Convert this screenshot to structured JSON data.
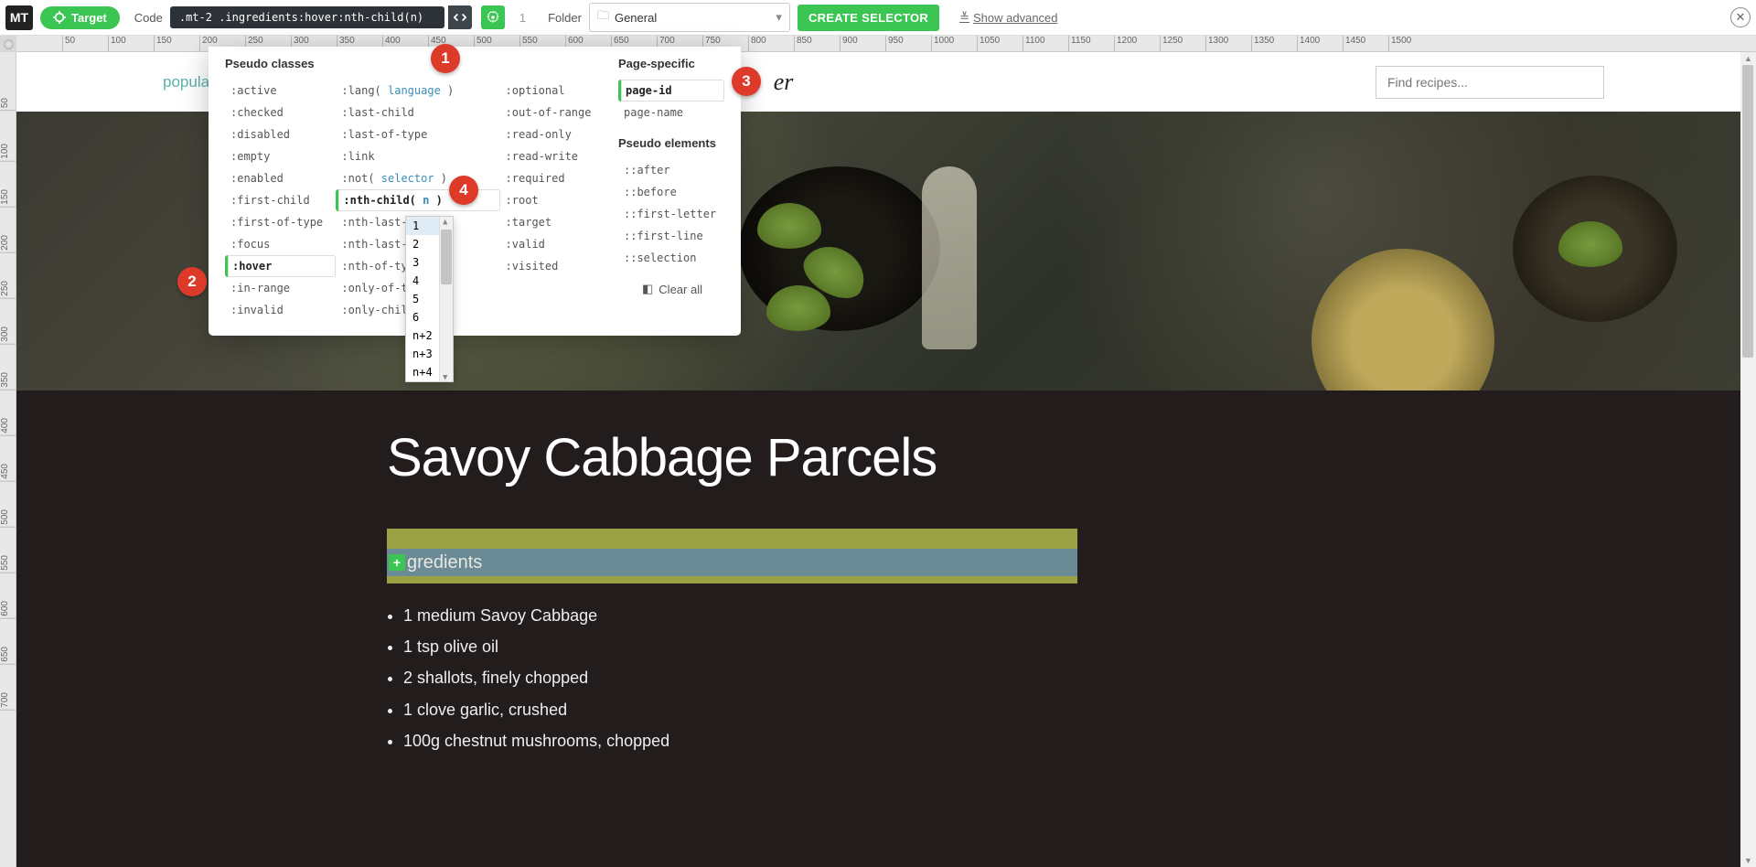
{
  "toolbar": {
    "mt_logo_text": "MT",
    "target_label": "Target",
    "code_label": "Code",
    "code_value": ".mt-2 .ingredients:hover:nth-child(n)",
    "count": "1",
    "folder_label": "Folder",
    "folder_value": "General",
    "create_label": "CREATE SELECTOR",
    "show_advanced": "Show advanced"
  },
  "popup": {
    "pseudo_classes_title": "Pseudo classes",
    "page_specific_title": "Page-specific",
    "pseudo_elements_title": "Pseudo elements",
    "clear_all": "Clear all",
    "col1": [
      ":active",
      ":checked",
      ":disabled",
      ":empty",
      ":enabled",
      ":first-child",
      ":first-of-type",
      ":focus",
      ":hover",
      ":in-range",
      ":invalid"
    ],
    "col2": [
      {
        "pre": ":lang(",
        "param": " language ",
        "post": ")"
      },
      {
        "pre": ":last-child"
      },
      {
        "pre": ":last-of-type"
      },
      {
        "pre": ":link"
      },
      {
        "pre": ":not(",
        "param": " selector ",
        "post": ")"
      },
      {
        "pre": ":nth-child(",
        "param": " n ",
        "post": ")"
      },
      {
        "pre": ":nth-last-c"
      },
      {
        "pre": ":nth-last-o",
        "post": ")"
      },
      {
        "pre": ":nth-of-typ"
      },
      {
        "pre": ":only-of-ty"
      },
      {
        "pre": ":only-child"
      }
    ],
    "col3": [
      ":optional",
      ":out-of-range",
      ":read-only",
      ":read-write",
      ":required",
      ":root",
      ":target",
      ":valid",
      ":visited"
    ],
    "page_specific": [
      "page-id",
      "page-name"
    ],
    "pseudo_elements": [
      "::after",
      "::before",
      "::first-letter",
      "::first-line",
      "::selection"
    ],
    "selected_col1": ":hover",
    "selected_col2": ":nth-child(",
    "selected_ps": "page-id",
    "n_options": [
      "1",
      "2",
      "3",
      "4",
      "5",
      "6",
      "n+2",
      "n+3",
      "n+4"
    ]
  },
  "badges": {
    "b1": "1",
    "b2": "2",
    "b3": "3",
    "b4": "4"
  },
  "page": {
    "nav_word": "popula",
    "logo_tail": "er",
    "search_placeholder": "Find recipes...",
    "recipe_title": "Savoy Cabbage Parcels",
    "ingredients_word": "gredients",
    "ingredients": [
      "1 medium Savoy Cabbage",
      "1 tsp olive oil",
      "2 shallots, finely chopped",
      "1 clove garlic, crushed",
      "100g chestnut mushrooms, chopped"
    ]
  },
  "ruler_h": [
    50,
    100,
    150,
    200,
    250,
    300,
    350,
    400,
    450,
    500,
    550,
    600,
    650,
    700,
    750,
    800,
    850,
    900,
    950,
    1000,
    1050,
    1100,
    1150,
    1200,
    1250,
    1300,
    1350,
    1400,
    1450,
    1500
  ],
  "ruler_v": [
    50,
    100,
    150,
    200,
    250,
    300,
    350,
    400,
    450,
    500,
    550,
    600,
    650,
    700
  ]
}
